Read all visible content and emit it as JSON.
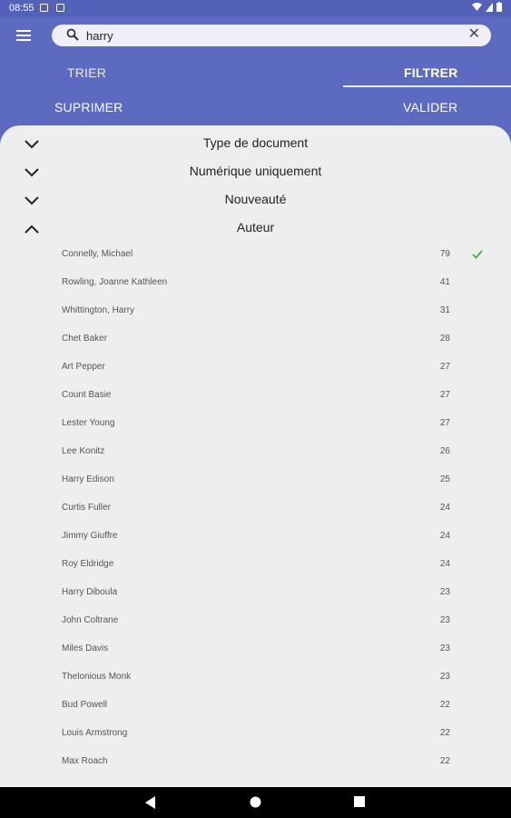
{
  "status": {
    "time": "08:55"
  },
  "search": {
    "value": "harry"
  },
  "tabs": {
    "trier": "TRIER",
    "filtrer": "FILTRER"
  },
  "actions": {
    "supprimer": "SUPRIMER",
    "valider": "VALIDER"
  },
  "sections": [
    {
      "label": "Type de document",
      "expanded": false
    },
    {
      "label": "Numérique uniquement",
      "expanded": false
    },
    {
      "label": "Nouveauté",
      "expanded": false
    },
    {
      "label": "Auteur",
      "expanded": true
    }
  ],
  "authors": [
    {
      "name": "Connelly, Michael",
      "count": "79",
      "selected": true
    },
    {
      "name": "Rowling, Joanne Kathleen",
      "count": "41",
      "selected": false
    },
    {
      "name": "Whittington, Harry",
      "count": "31",
      "selected": false
    },
    {
      "name": "Chet Baker",
      "count": "28",
      "selected": false
    },
    {
      "name": "Art Pepper",
      "count": "27",
      "selected": false
    },
    {
      "name": "Count Basie",
      "count": "27",
      "selected": false
    },
    {
      "name": "Lester Young",
      "count": "27",
      "selected": false
    },
    {
      "name": "Lee Konitz",
      "count": "26",
      "selected": false
    },
    {
      "name": "Harry Edison",
      "count": "25",
      "selected": false
    },
    {
      "name": "Curtis Fuller",
      "count": "24",
      "selected": false
    },
    {
      "name": "Jimmy Giuffre",
      "count": "24",
      "selected": false
    },
    {
      "name": "Roy Eldridge",
      "count": "24",
      "selected": false
    },
    {
      "name": "Harry Diboula",
      "count": "23",
      "selected": false
    },
    {
      "name": "John Coltrane",
      "count": "23",
      "selected": false
    },
    {
      "name": "Miles Davis",
      "count": "23",
      "selected": false
    },
    {
      "name": "Thelonious Monk",
      "count": "23",
      "selected": false
    },
    {
      "name": "Bud Powell",
      "count": "22",
      "selected": false
    },
    {
      "name": "Louis Armstrong",
      "count": "22",
      "selected": false
    },
    {
      "name": "Max Roach",
      "count": "22",
      "selected": false
    }
  ],
  "colors": {
    "accent": "#5c6bc0",
    "check": "#4caf50",
    "sheet": "#eeeeee"
  },
  "icons": {
    "menu": "menu-icon",
    "search": "search-icon",
    "clear": "close-icon",
    "expand": "chevron-down-icon",
    "collapse": "chevron-up-icon",
    "check": "check-icon",
    "back": "back-icon",
    "home": "home-icon",
    "recents": "recents-icon"
  }
}
